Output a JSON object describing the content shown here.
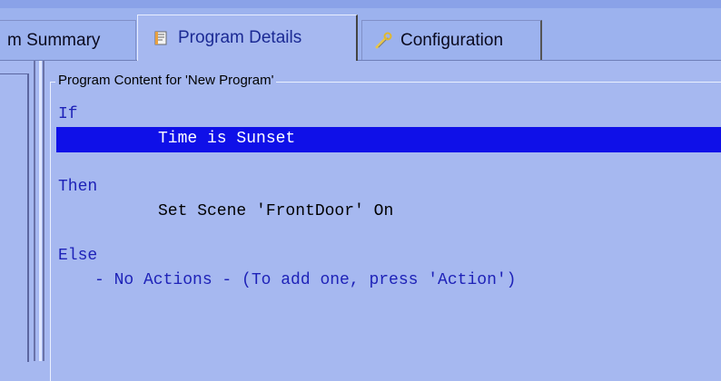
{
  "tabs": [
    {
      "label": "m Summary",
      "icon": "summary-icon"
    },
    {
      "label": "Program Details",
      "icon": "document-icon",
      "active": true
    },
    {
      "label": "Configuration",
      "icon": "wrench-icon"
    }
  ],
  "program": {
    "content_title": "Program Content for 'New Program'",
    "if_keyword": "If",
    "condition": "Time is Sunset",
    "then_keyword": "Then",
    "then_action": "Set Scene 'FrontDoor' On",
    "else_keyword": "Else",
    "else_action": "- No Actions - (To add one, press 'Action')"
  },
  "colors": {
    "background": "#a6b8f0",
    "selection": "#0f10e8",
    "keyword": "#1e22b8"
  }
}
